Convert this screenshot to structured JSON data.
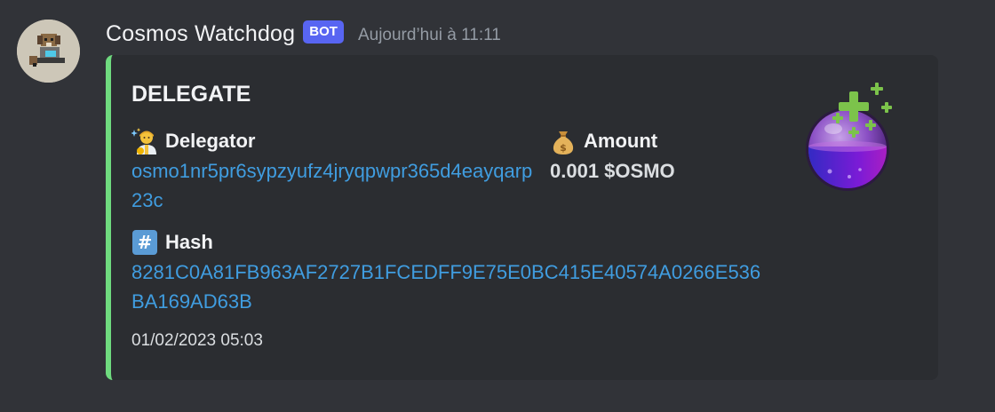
{
  "message": {
    "author": "Cosmos Watchdog",
    "tag": "BOT",
    "timestamp": "Aujourd’hui à 11:11"
  },
  "embed": {
    "accent_color": "#6fdb7f",
    "title": "DELEGATE",
    "fields": {
      "delegator": {
        "icon": "person-sparkles-emoji",
        "name": "Delegator",
        "value": "osmo1nr5pr6sypzyufz4jryqpwpr365d4eayqarp23c"
      },
      "amount": {
        "icon": "money-bag-emoji",
        "name": "Amount",
        "value": "0.001 $OSMO"
      },
      "hash": {
        "icon": "hash-keycap-emoji",
        "name": "Hash",
        "value": "8281C0A81FB963AF2727B1FCEDFF9E75E0BC415E40574A0266E536BA169AD63B"
      }
    },
    "footer": "01/02/2023 05:03",
    "thumbnail": "potion-plus-icon"
  },
  "colors": {
    "background": "#313338",
    "embed_bg": "#2b2d31",
    "link": "#409de0",
    "bot_tag": "#5865f2"
  }
}
